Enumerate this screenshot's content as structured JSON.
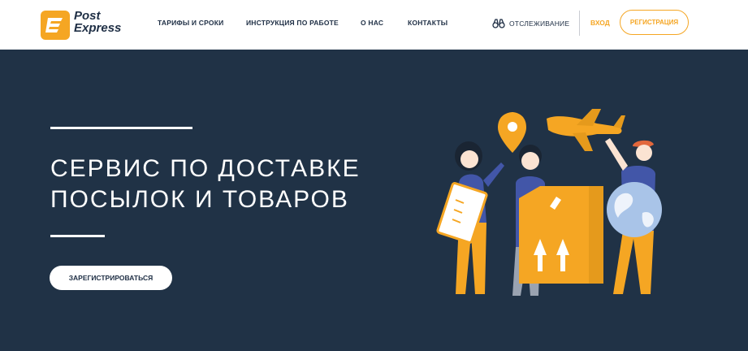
{
  "header": {
    "logo": {
      "line1": "Post",
      "line2": "Express",
      "icon": "post-express-logo-icon"
    },
    "nav": [
      "ТАРИФЫ И СРОКИ",
      "ИНСТРУКЦИЯ ПО РАБОТЕ",
      "О НАС",
      "КОНТАКТЫ"
    ],
    "tracking": {
      "label": "ОТСЛЕЖИВАНИЕ",
      "icon": "binoculars-icon"
    },
    "login_label": "ВХОД",
    "register_label": "РЕГИСТРАЦИЯ"
  },
  "hero": {
    "title_line1": "СЕРВИС ПО ДОСТАВКЕ",
    "title_line2": "ПОСЫЛОК И ТОВАРОВ",
    "cta_label": "ЗАРЕГИСТРИРОВАТЬСЯ"
  },
  "colors": {
    "accent": "#f5a623",
    "dark": "#1f2f45",
    "hero_bg": "#203246"
  }
}
